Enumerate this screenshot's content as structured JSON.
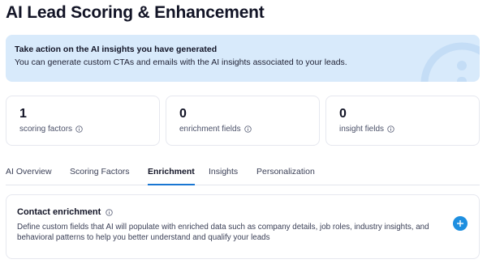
{
  "page": {
    "title": "AI Lead Scoring & Enhancement"
  },
  "banner": {
    "title": "Take action on the AI insights you have generated",
    "text": "You can generate custom CTAs and emails with the AI insights associated to your leads.",
    "icon": "info-icon"
  },
  "stats": [
    {
      "value": "1",
      "label": "scoring factors",
      "icon": "info-icon"
    },
    {
      "value": "0",
      "label": "enrichment fields",
      "icon": "info-icon"
    },
    {
      "value": "0",
      "label": "insight fields",
      "icon": "info-icon"
    }
  ],
  "tabs": [
    {
      "label": "AI Overview",
      "active": false
    },
    {
      "label": "Scoring Factors",
      "active": false
    },
    {
      "label": "Enrichment",
      "active": true
    },
    {
      "label": "Insights",
      "active": false
    },
    {
      "label": "Personalization",
      "active": false
    }
  ],
  "enrichment": {
    "title": "Contact enrichment",
    "description": "Define custom fields that AI will populate with enriched data such as company details, job roles, industry insights, and behavioral patterns to help you better understand and qualify your leads",
    "add_icon": "plus-icon"
  },
  "colors": {
    "accent": "#1976d2",
    "banner_bg": "#d8eafb",
    "add_button": "#1e8fe0"
  }
}
